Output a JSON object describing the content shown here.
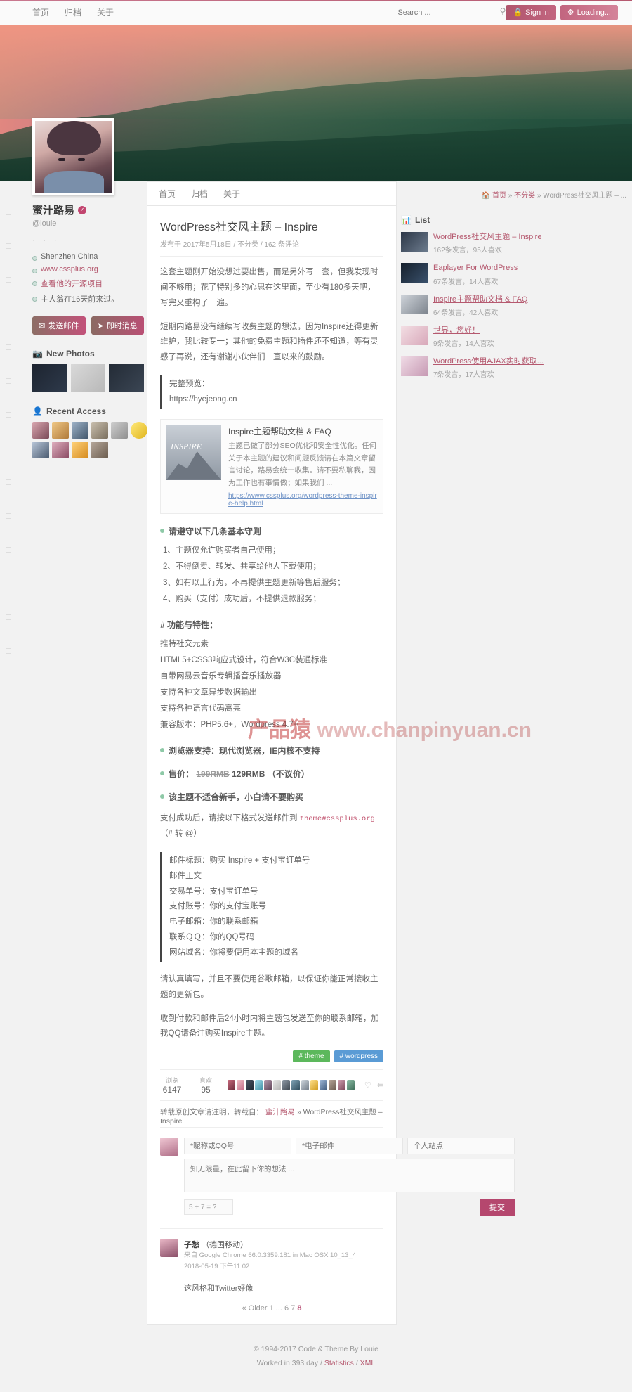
{
  "topbar": {
    "nav": [
      {
        "label": "首页"
      },
      {
        "label": "归档"
      },
      {
        "label": "关于"
      }
    ],
    "search_placeholder": "Search ...",
    "search_value": "",
    "signin_label": "Sign in",
    "loading_label": "Loading..."
  },
  "profile": {
    "name": "蜜汁路易",
    "handle": "@louie",
    "dots": "· · ·",
    "meta": [
      {
        "label": "Shenzhen China",
        "link": false
      },
      {
        "label": "www.cssplus.org",
        "link": true
      },
      {
        "label": "查看他的开源项目",
        "link": true
      },
      {
        "label": "主人翁在16天前来过。",
        "link": false
      }
    ],
    "btn_mail": "发送邮件",
    "btn_msg": "即时消息",
    "photos_title": "New Photos",
    "recent_title": "Recent Access"
  },
  "midnav": {
    "items": [
      {
        "label": "首页"
      },
      {
        "label": "归档"
      },
      {
        "label": "关于"
      }
    ]
  },
  "breadcrumb": {
    "home": "首页",
    "category": "不分类",
    "current": "WordPress社交风主题 – ...",
    "sep": "»"
  },
  "post": {
    "title": "WordPress社交风主题 – Inspire",
    "meta": "发布于 2017年5月18日 / 不分类 / 162 条评论",
    "para1": "这套主题刚开始没想过要出售，而是另外写一套，但我发现时间不够用；花了特别多的心思在这里面，至少有180多天吧，写完又重构了一遍。",
    "para2": "短期内路易没有继续写收费主题的想法，因为Inspire还得更新维护，我比较专一；其他的免费主题和插件还不知道，等有灵感了再说，还有谢谢小伙伴们一直以来的鼓励。",
    "quote_label": "完整预览：",
    "quote_url": "https://hyejeong.cn",
    "linkcard": {
      "thumb_text": "INSPIRE",
      "title": "Inspire主题帮助文档 & FAQ",
      "desc": "主题已做了部分SEO优化和安全性优化。任何关于本主题的建议和问题反馈请在本篇文章留言讨论，路易会统一收集。请不要私聊我，因为工作也有事情做；如果我们 ...",
      "url": "https://www.cssplus.org/wordpress-theme-inspire-help.html"
    },
    "rules_title": "请遵守以下几条基本守则",
    "rules": [
      "1、主题仅允许购买者自己使用；",
      "2、不得倒卖、转发、共享给他人下载使用；",
      "3、如有以上行为，不再提供主题更新等售后服务；",
      "4、购买（支付）成功后，不提供退款服务；"
    ],
    "features_title": "# 功能与特性：",
    "features": [
      "推特社交元素",
      "HTML5+CSS3响应式设计，符合W3C装通标准",
      "自带网易云音乐专辑播音乐播放器",
      "支持各种文章异步数据输出",
      "支持各种语言代码高亮",
      "兼容版本：PHP5.6+，Wordpress 4.7+"
    ],
    "browser_line": "浏览器支持：现代浏览器，IE内核不支持",
    "price_label": "售价：",
    "price_old": "199RMB",
    "price_new": "129RMB",
    "price_note": "（不议价）",
    "newbie_line": "该主题不适合新手，小白请不要购买",
    "pay_line_pre": "支付成功后，请按以下格式发送邮件到",
    "pay_email": "theme#cssplus.org",
    "pay_line_post": "（# 转 @）",
    "mail_fields": [
      "邮件标题：购买 Inspire + 支付宝订单号",
      "邮件正文",
      "交易单号：支付宝订单号",
      "支付账号：你的支付宝账号",
      "电子邮箱：你的联系邮箱",
      "联系ＱＱ：你的QQ号码",
      "网站域名：你将要使用本主题的域名"
    ],
    "note1": "请认真填写，并且不要使用谷歌邮箱，以保证你能正常接收主题的更新包。",
    "note2": "收到付款和邮件后24小时内将主题包发送至你的联系邮箱，加我QQ请备注购买Inspire主题。",
    "tags": [
      {
        "label": "# theme",
        "color": "#5cb85c"
      },
      {
        "label": "# wordpress",
        "color": "#5a9bd5"
      }
    ],
    "stats": [
      {
        "key": "浏览",
        "value": "6147"
      },
      {
        "key": "喜欢",
        "value": "95"
      }
    ],
    "repost_pre": "转载原创文章请注明，转载自：",
    "repost_author": "蜜汁路易",
    "repost_sep": "»",
    "repost_title": "WordPress社交风主题 – Inspire"
  },
  "comment_form": {
    "name_placeholder": "*昵称或QQ号",
    "email_placeholder": "*电子邮件",
    "site_placeholder": "个人站点",
    "text_placeholder": "知无限量，在此留下你的想法 ...",
    "captcha": "5 + 7 = ?",
    "submit": "提交"
  },
  "comments": [
    {
      "name": "子愁",
      "from": "（德国移动）",
      "ua": "来自 Google Chrome 66.0.3359.181 in Mac OSX 10_13_4",
      "time": "2018-05-19 下午11:02",
      "text": "这风格和Twitter好像"
    }
  ],
  "pager": {
    "older": "« Older",
    "pages": [
      "1",
      "...",
      "6",
      "7",
      "8"
    ],
    "current": "8"
  },
  "sidebar_right": {
    "title": "List",
    "items": [
      {
        "title": "WordPress社交风主题 – Inspire",
        "stats": "162条发言，95人喜欢"
      },
      {
        "title": "Eaplayer For WordPress",
        "stats": "67条发言，14人喜欢"
      },
      {
        "title": "Inspire主题帮助文档 & FAQ",
        "stats": "64条发言，42人喜欢"
      },
      {
        "title": "世界，您好！",
        "stats": "9条发言，14人喜欢"
      },
      {
        "title": "WordPress使用AJAX实时获取...",
        "stats": "7条发言，17人喜欢"
      }
    ]
  },
  "footer": {
    "line1": "© 1994-2017   Code & Theme By Louie",
    "line2_pre": "Worked in 393 day /",
    "stats_link": "Statistics",
    "sep": "/",
    "xml_link": "XML"
  },
  "watermark": {
    "text_a": "产品猿",
    "text_b": "www.chanpinyuan.cn"
  },
  "colors": {
    "accent": "#b5596f",
    "pink": "#c2456f",
    "green_tag": "#5cb85c",
    "blue_tag": "#5a9bd5"
  }
}
